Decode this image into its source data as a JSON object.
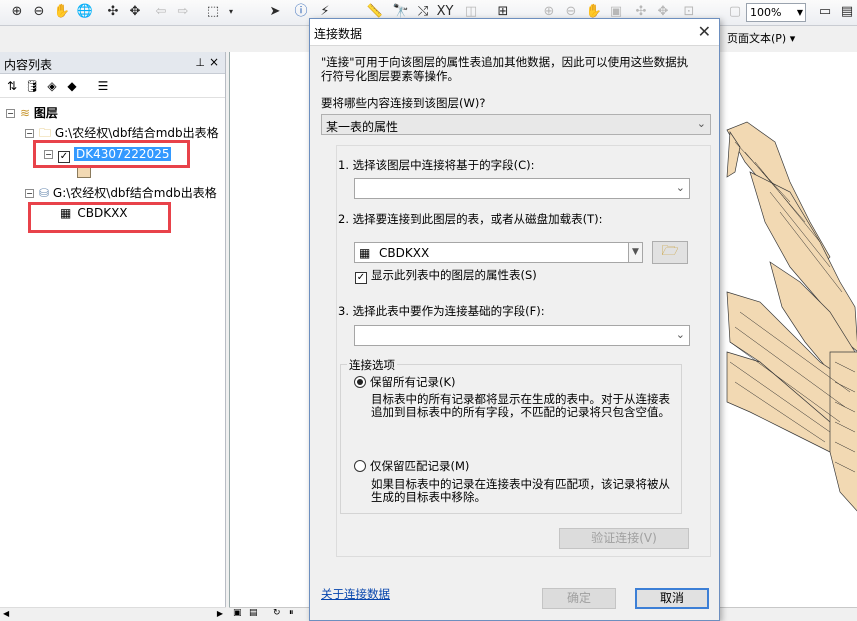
{
  "toolbar": {
    "zoom_level": "100%",
    "page_text_menu": "页面文本(P)"
  },
  "toc": {
    "title": "内容列表",
    "layers_root": "图层",
    "group1_path": "G:\\农经权\\dbf结合mdb出表格",
    "layer_name": "DK4307222025",
    "group2_path": "G:\\农经权\\dbf结合mdb出表格",
    "table_name": "CBDKXX"
  },
  "dialog": {
    "title": "连接数据",
    "intro": "\"连接\"可用于向该图层的属性表追加其他数据，因此可以使用这些数据执行符号化图层要素等操作。",
    "intro_line1": "\"连接\"可用于向该图层的属性表追加其他数据，因此可以使用这些数据执",
    "intro_line2": "行符号化图层要素等操作。",
    "what_to_join_label": "要将哪些内容连接到该图层(W)?",
    "what_to_join_value": "某一表的属性",
    "step1_label": "1. 选择该图层中连接将基于的字段(C):",
    "step1_value": "",
    "step2_label": "2. 选择要连接到此图层的表，或者从磁盘加载表(T):",
    "step2_value": "CBDKXX",
    "show_attr_tables_label": "显示此列表中的图层的属性表(S)",
    "step3_label": "3. 选择此表中要作为连接基础的字段(F):",
    "step3_value": "",
    "join_options_label": "连接选项",
    "keep_all_label": "保留所有记录(K)",
    "keep_all_desc_line1": "目标表中的所有记录都将显示在生成的表中。对于从连接表",
    "keep_all_desc_line2": "追加到目标表中的所有字段，不匹配的记录将只包含空值。",
    "keep_matching_label": "仅保留匹配记录(M)",
    "keep_matching_desc_line1": "如果目标表中的记录在连接表中没有匹配项，该记录将被从",
    "keep_matching_desc_line2": "生成的目标表中移除。",
    "validate_button": "验证连接(V)",
    "about_link": "关于连接数据",
    "ok_button": "确定",
    "cancel_button": "取消"
  }
}
